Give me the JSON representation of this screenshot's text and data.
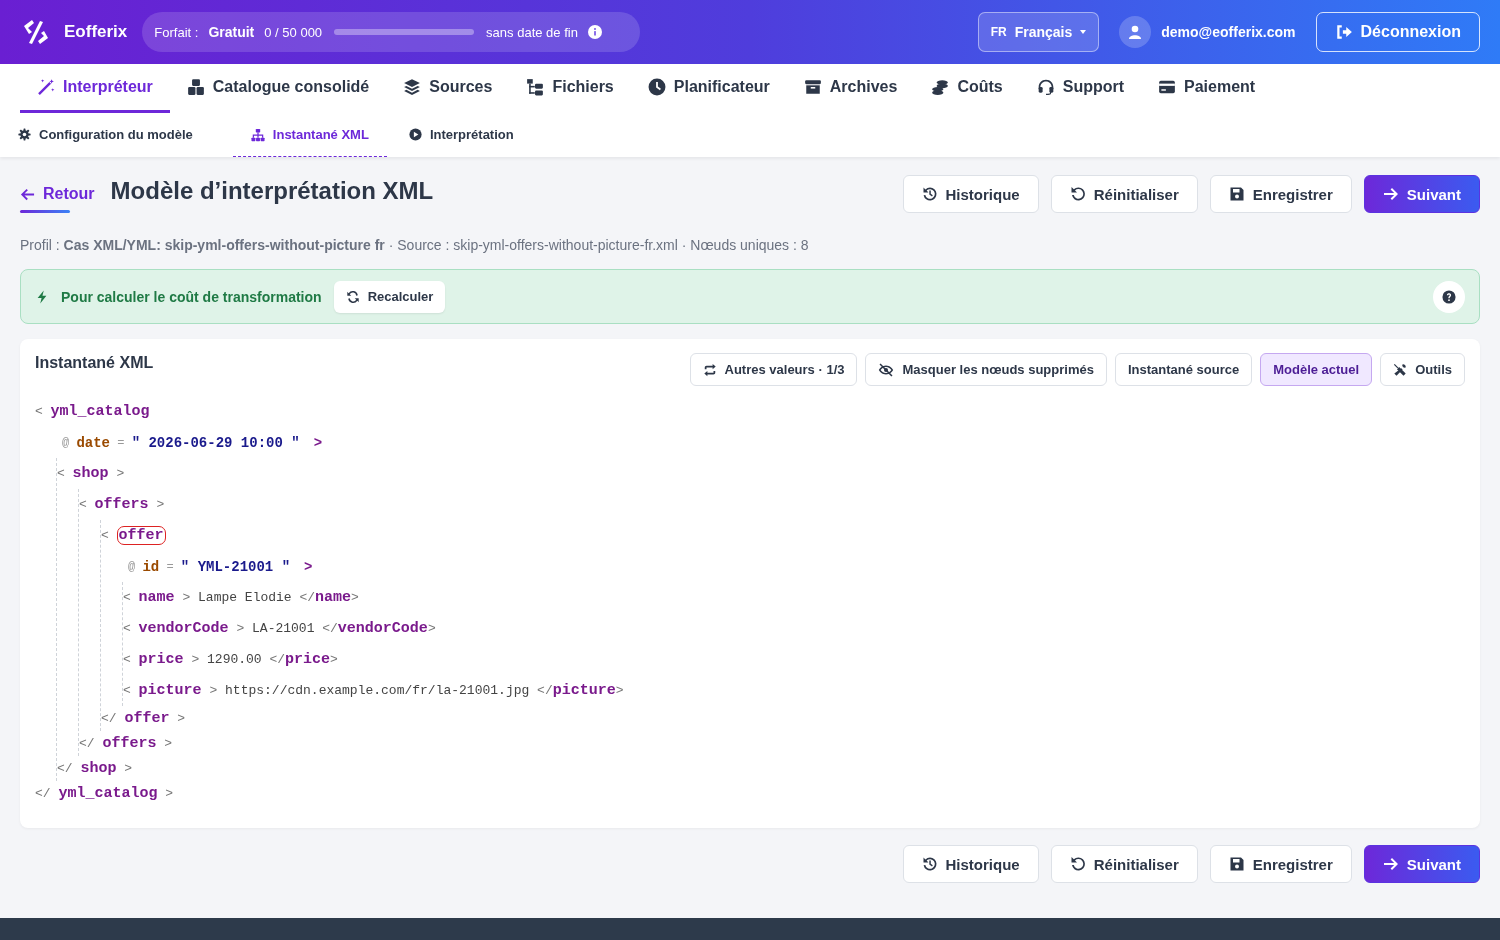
{
  "header": {
    "brand": "Eofferix",
    "plan": {
      "label": "Forfait :",
      "name": "Gratuit",
      "usage": "0 / 50 000",
      "level": 0,
      "expiry": "sans date de fin"
    },
    "language": {
      "code": "FR",
      "name": "Français"
    },
    "user": "demo@eofferix.com",
    "logout": "Déconnexion"
  },
  "nav": [
    {
      "label": "Interpréteur",
      "selected": true
    },
    {
      "label": "Catalogue consolidé",
      "selected": false
    },
    {
      "label": "Sources",
      "selected": false
    },
    {
      "label": "Fichiers",
      "selected": false
    },
    {
      "label": "Planificateur",
      "selected": false
    },
    {
      "label": "Archives",
      "selected": false
    },
    {
      "label": "Coûts",
      "selected": false
    },
    {
      "label": "Support",
      "selected": false
    },
    {
      "label": "Paiement",
      "selected": false
    }
  ],
  "subtabs": [
    {
      "label": "Configuration du modèle",
      "selected": false
    },
    {
      "label": "Instantané XML",
      "selected": true
    },
    {
      "label": "Interprétation",
      "selected": false
    }
  ],
  "page": {
    "back": "Retour",
    "title": "Modèle d’interprétation XML",
    "actions": [
      {
        "label": "Historique",
        "kind": "default"
      },
      {
        "label": "Réinitialiser",
        "kind": "default"
      },
      {
        "label": "Enregistrer",
        "kind": "default"
      },
      {
        "label": "Suivant",
        "kind": "primary"
      }
    ],
    "info": "Profil : **Cas XML/YML: skip-yml-offers-without-picture fr** · Source : skip-yml-offers-without-picture-fr.xml · Nœuds uniques : 8",
    "notice": {
      "text": "Pour calculer le coût de transformation",
      "button": "Recalculer"
    },
    "panel": {
      "title": "Instantané XML",
      "tools": [
        {
          "label": "Autres valeurs · 1/3",
          "selected": false
        },
        {
          "label": "Masquer les nœuds supprimés",
          "selected": false
        },
        {
          "label": "Instantané source",
          "selected": false
        },
        {
          "label": "Modèle actuel",
          "selected": true
        },
        {
          "label": "Outils",
          "selected": false
        }
      ],
      "syntax": {
        "open": "<",
        "close": ">",
        "end": "</",
        "attr": "@",
        "eq": "=",
        "quote": "\""
      },
      "tree": {
        "tag": "yml_catalog",
        "close_tag": "yml_catalog",
        "attributes": [
          {
            "name": "date",
            "value": "2026-06-29 10:00"
          }
        ],
        "children": [
          {
            "tag": "shop",
            "close_tag": "shop",
            "children": [
              {
                "tag": "offers",
                "close_tag": "offers",
                "children": [
                  {
                    "tag": "offer",
                    "close_tag": "offer",
                    "highlighted": true,
                    "attributes": [
                      {
                        "name": "id",
                        "value": "YML-21001"
                      }
                    ],
                    "children": [
                      {
                        "tag": "name",
                        "text": "Lampe Elodie",
                        "close_tag": "name"
                      },
                      {
                        "tag": "vendorCode",
                        "text": "LA-21001",
                        "close_tag": "vendorCode"
                      },
                      {
                        "tag": "price",
                        "text": "1290.00",
                        "close_tag": "price"
                      },
                      {
                        "tag": "picture",
                        "text": "https://cdn.example.com/fr/la-21001.jpg",
                        "close_tag": "picture"
                      }
                    ]
                  }
                ]
              }
            ]
          }
        ]
      }
    }
  },
  "bottom_actions": [
    {
      "label": "Historique",
      "kind": "default"
    },
    {
      "label": "Réinitialiser",
      "kind": "default"
    },
    {
      "label": "Enregistrer",
      "kind": "default"
    },
    {
      "label": "Suivant",
      "kind": "primary"
    }
  ]
}
